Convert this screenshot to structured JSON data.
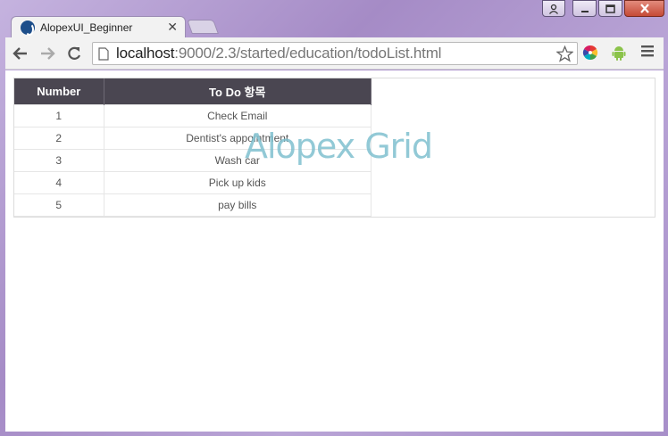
{
  "window": {
    "tab_title": "AlopexUI_Beginner",
    "tab_close": "✕"
  },
  "address": {
    "host": "localhost",
    "path": ":9000/2.3/started/education/todoList.html"
  },
  "grid": {
    "watermark": "Alopex Grid",
    "headers": [
      "Number",
      "To Do 항목"
    ],
    "rows": [
      {
        "number": "1",
        "todo": "Check Email"
      },
      {
        "number": "2",
        "todo": "Dentist's appointment"
      },
      {
        "number": "3",
        "todo": "Wash car"
      },
      {
        "number": "4",
        "todo": "Pick up kids"
      },
      {
        "number": "5",
        "todo": "pay bills"
      }
    ]
  },
  "colors": {
    "header_bg": "#4a4651",
    "watermark": "#7fc0cf",
    "window_frame": "#b59fd0"
  },
  "icons": [
    "user-icon",
    "minimize-icon",
    "maximize-icon",
    "close-icon",
    "page-icon",
    "back-arrow-icon",
    "forward-arrow-icon",
    "reload-icon",
    "star-icon",
    "color-wheel-icon",
    "android-icon",
    "menu-icon"
  ]
}
